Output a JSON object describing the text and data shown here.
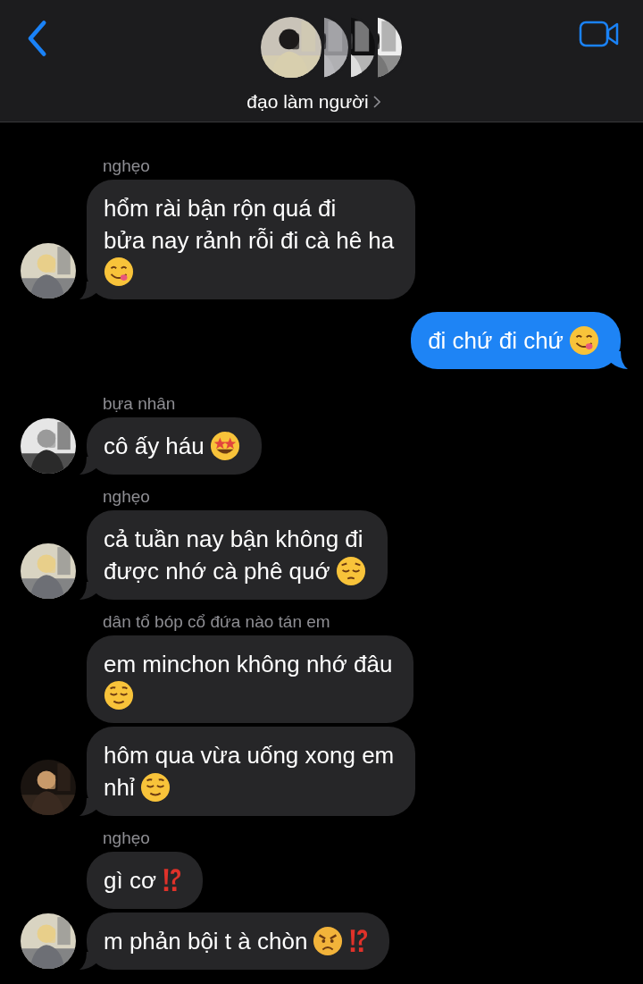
{
  "header": {
    "title": "đạo làm người"
  },
  "items": [
    {
      "kind": "incoming",
      "sender": "nghẹo",
      "messages": [
        {
          "lines": [
            {
              "text": "hổm rài bận rộn quá đi"
            },
            {
              "text": "bửa nay rảnh rỗi đi cà hê ha"
            },
            {
              "emoji": [
                {
                  "kind": "yum"
                }
              ]
            }
          ]
        }
      ]
    },
    {
      "kind": "outgoing",
      "messages": [
        {
          "lines": [
            {
              "text": "đi chứ đi chứ",
              "emoji": [
                {
                  "kind": "yum"
                }
              ]
            }
          ]
        }
      ]
    },
    {
      "kind": "incoming",
      "sender": "bựa nhân",
      "messages": [
        {
          "lines": [
            {
              "text": "cô ấy háu",
              "emoji": [
                {
                  "kind": "starstruck"
                }
              ]
            }
          ]
        }
      ]
    },
    {
      "kind": "incoming",
      "sender": "nghẹo",
      "messages": [
        {
          "lines": [
            {
              "text": "cả tuần nay bận không đi"
            },
            {
              "text": "được nhớ cà phê quớ",
              "emoji": [
                {
                  "kind": "pensive"
                }
              ]
            }
          ]
        }
      ]
    },
    {
      "kind": "incoming",
      "sender": "dân tổ bóp cổ đứa nào tán em",
      "messages": [
        {
          "lines": [
            {
              "text": "em minchon không nhớ đâu"
            },
            {
              "emoji": [
                {
                  "kind": "relieved"
                }
              ]
            }
          ]
        },
        {
          "lines": [
            {
              "text": "hôm qua vừa uống xong em"
            },
            {
              "text": "nhỉ",
              "emoji": [
                {
                  "kind": "relieved"
                }
              ]
            }
          ]
        }
      ]
    },
    {
      "kind": "incoming",
      "sender": "nghẹo",
      "messages": [
        {
          "lines": [
            {
              "text": "gì cơ",
              "emoji": [
                {
                  "kind": "interrobang"
                }
              ]
            }
          ]
        },
        {
          "lines": [
            {
              "text": "m phản bội t à chòn",
              "emoji": [
                {
                  "kind": "angry"
                },
                {
                  "kind": "interrobang"
                }
              ]
            }
          ]
        }
      ]
    }
  ]
}
